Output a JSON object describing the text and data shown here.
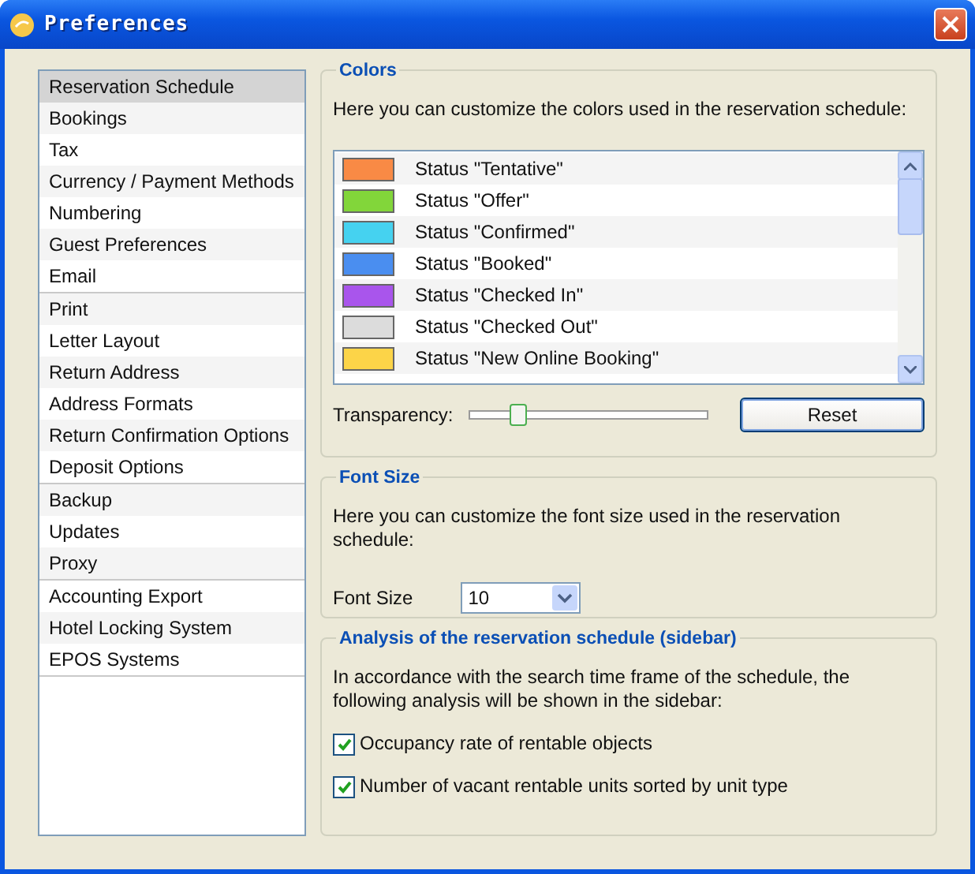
{
  "window": {
    "title": "Preferences"
  },
  "sidebar": {
    "groups": [
      {
        "items": [
          {
            "label": "Reservation Schedule",
            "selected": true
          },
          {
            "label": "Bookings",
            "selected": false
          },
          {
            "label": "Tax",
            "selected": false
          },
          {
            "label": "Currency / Payment Methods",
            "selected": false
          },
          {
            "label": "Numbering",
            "selected": false
          },
          {
            "label": "Guest Preferences",
            "selected": false
          },
          {
            "label": "Email",
            "selected": false
          }
        ]
      },
      {
        "items": [
          {
            "label": "Print",
            "selected": false
          },
          {
            "label": "Letter Layout",
            "selected": false
          },
          {
            "label": "Return Address",
            "selected": false
          },
          {
            "label": "Address Formats",
            "selected": false
          },
          {
            "label": "Return Confirmation Options",
            "selected": false
          },
          {
            "label": "Deposit Options",
            "selected": false
          }
        ]
      },
      {
        "items": [
          {
            "label": "Backup",
            "selected": false
          },
          {
            "label": "Updates",
            "selected": false
          },
          {
            "label": "Proxy",
            "selected": false
          }
        ]
      },
      {
        "items": [
          {
            "label": "Accounting Export",
            "selected": false
          },
          {
            "label": "Hotel Locking System",
            "selected": false
          },
          {
            "label": "EPOS Systems",
            "selected": false
          }
        ]
      }
    ]
  },
  "colors": {
    "title": "Colors",
    "description": "Here you can customize the colors used in the reservation schedule:",
    "statuses": [
      {
        "label": "Status \"Tentative\"",
        "color": "#f98a45"
      },
      {
        "label": "Status \"Offer\"",
        "color": "#82d63a"
      },
      {
        "label": "Status \"Confirmed\"",
        "color": "#45d2f0"
      },
      {
        "label": "Status \"Booked\"",
        "color": "#4a8ef0"
      },
      {
        "label": "Status \"Checked In\"",
        "color": "#a955ec"
      },
      {
        "label": "Status \"Checked Out\"",
        "color": "#dcdcdc"
      },
      {
        "label": "Status \"New Online Booking\"",
        "color": "#fcd448"
      }
    ],
    "transparency": {
      "label": "Transparency:",
      "level": 0.2
    },
    "reset_button": "Reset"
  },
  "font_size": {
    "title": "Font Size",
    "description": "Here you can customize the font size used in the reservation schedule:",
    "label": "Font Size",
    "value": "10"
  },
  "analysis": {
    "title": "Analysis of the reservation schedule (sidebar)",
    "description": "In accordance with the search time frame of the schedule, the following analysis will be shown in the sidebar:",
    "options": [
      {
        "label": "Occupancy rate of rentable objects",
        "checked": true
      },
      {
        "label": "Number of vacant rentable units sorted by unit type",
        "checked": true
      }
    ]
  }
}
